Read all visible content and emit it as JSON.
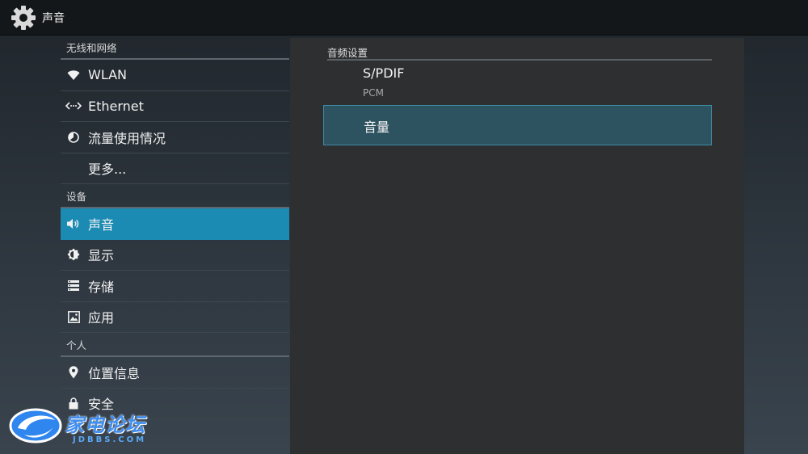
{
  "header": {
    "title": "声音",
    "icon": "settings-gear-icon"
  },
  "sidebar": {
    "sections": [
      {
        "category": "无线和网络",
        "items": [
          {
            "label": "WLAN",
            "icon": "wifi-icon"
          },
          {
            "label": "Ethernet",
            "icon": "ethernet-icon"
          },
          {
            "label": "流量使用情况",
            "icon": "data-usage-icon"
          },
          {
            "label": "更多...",
            "icon": ""
          }
        ]
      },
      {
        "category": "设备",
        "items": [
          {
            "label": "声音",
            "icon": "speaker-icon",
            "active": true
          },
          {
            "label": "显示",
            "icon": "brightness-icon"
          },
          {
            "label": "存储",
            "icon": "storage-icon"
          },
          {
            "label": "应用",
            "icon": "apps-icon"
          }
        ]
      },
      {
        "category": "个人",
        "items": [
          {
            "label": "位置信息",
            "icon": "location-pin-icon"
          },
          {
            "label": "安全",
            "icon": "lock-icon"
          }
        ]
      }
    ]
  },
  "panel": {
    "header": "音频设置",
    "spdif": {
      "title": "S/PDIF",
      "summary": "PCM"
    },
    "volume": {
      "title": "音量"
    }
  },
  "watermark": {
    "text": "家电论坛",
    "sub": "JDBBS.COM"
  },
  "colors": {
    "active": "#1b8bb4",
    "selected_pref": "#2e5360",
    "topbar": "#141719",
    "panel": "#2d2f31"
  }
}
